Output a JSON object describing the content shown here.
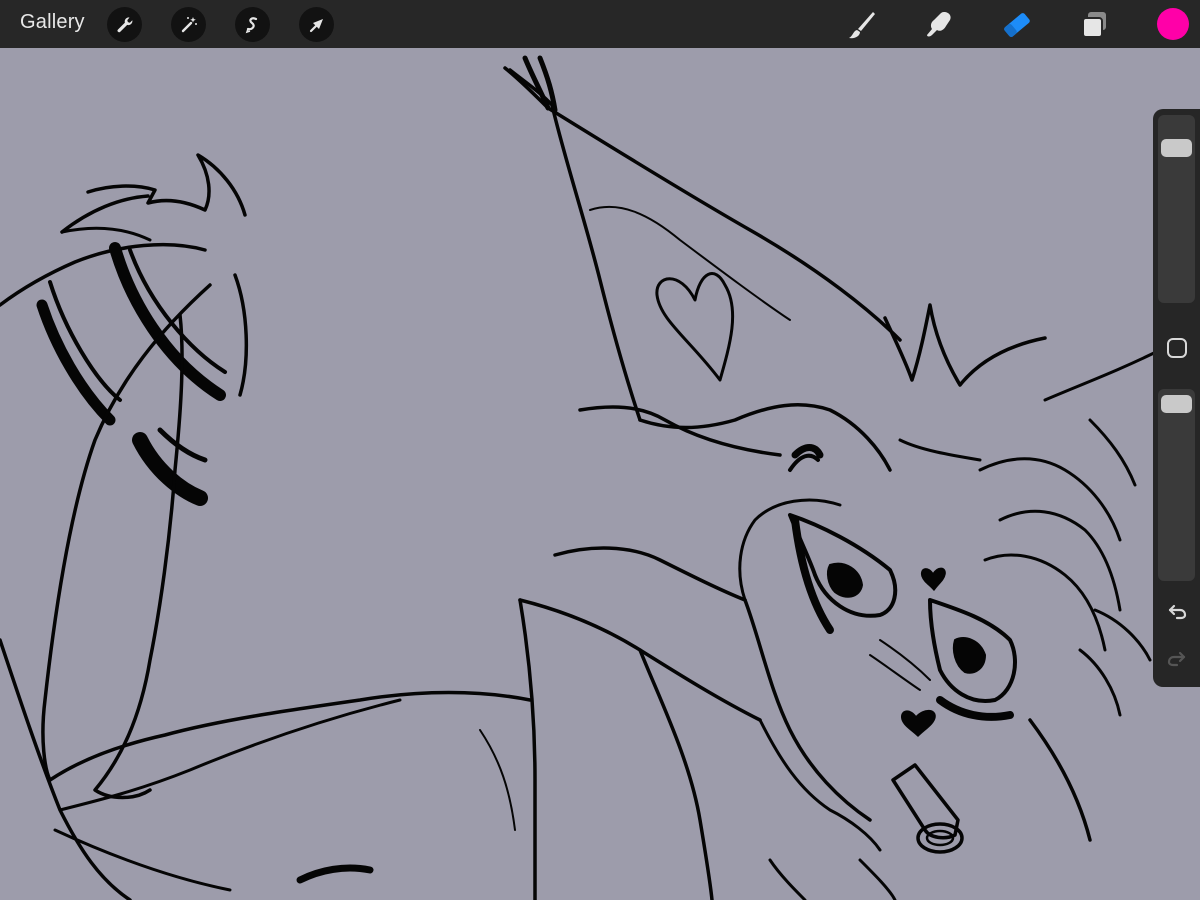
{
  "app": {
    "gallery_label": "Gallery"
  },
  "toolbar": {
    "left_icons": [
      "wrench-icon",
      "magic-wand-icon",
      "selection-icon",
      "transform-arrow-icon"
    ],
    "right_icons": [
      "brush-icon",
      "smudge-icon",
      "eraser-icon",
      "layers-icon"
    ],
    "active_tool": "eraser",
    "active_color": "#ff00a8",
    "accent_color": "#1d8cf8"
  },
  "sidebar": {
    "size_slider_level": 0.06,
    "opacity_slider_level": 0.02,
    "icons": [
      "modify-square-icon",
      "undo-icon",
      "redo-icon"
    ]
  },
  "canvas": {
    "background_color": "#9d9cab",
    "content": "lineart-sketch"
  }
}
